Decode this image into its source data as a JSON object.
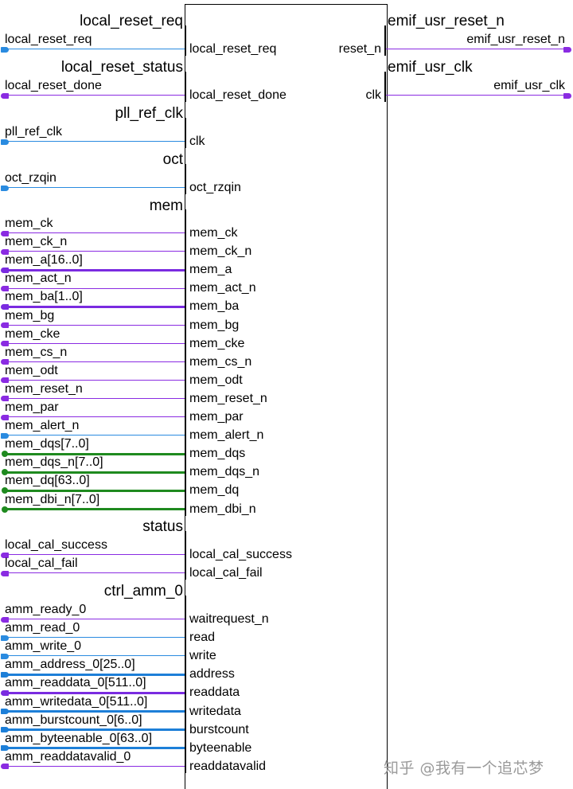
{
  "colors": {
    "blue": "#2a8be0",
    "purple": "#8a2be2",
    "green": "#1f8a1f",
    "bus_blue": "#1d7fd8",
    "bus_purple": "#7a2be0"
  },
  "output_groups": [
    {
      "group": "emif_usr_reset_n",
      "signal": "emif_usr_reset_n",
      "port": "reset_n",
      "color": "purple"
    },
    {
      "group": "emif_usr_clk",
      "signal": "emif_usr_clk",
      "port": "clk",
      "color": "purple"
    }
  ],
  "input_groups": [
    {
      "group": "local_reset_req",
      "signals": [
        {
          "name": "local_reset_req",
          "port": "local_reset_req",
          "color": "blue",
          "bus": false,
          "term": "in"
        }
      ]
    },
    {
      "group": "local_reset_status",
      "signals": [
        {
          "name": "local_reset_done",
          "port": "local_reset_done",
          "color": "purple",
          "bus": false,
          "term": "out"
        }
      ]
    },
    {
      "group": "pll_ref_clk",
      "signals": [
        {
          "name": "pll_ref_clk",
          "port": "clk",
          "color": "blue",
          "bus": false,
          "term": "in"
        }
      ]
    },
    {
      "group": "oct",
      "signals": [
        {
          "name": "oct_rzqin",
          "port": "oct_rzqin",
          "color": "blue",
          "bus": false,
          "term": "in"
        }
      ]
    },
    {
      "group": "mem",
      "signals": [
        {
          "name": "mem_ck",
          "port": "mem_ck",
          "color": "purple",
          "bus": false,
          "term": "out"
        },
        {
          "name": "mem_ck_n",
          "port": "mem_ck_n",
          "color": "purple",
          "bus": false,
          "term": "out"
        },
        {
          "name": "mem_a[16..0]",
          "port": "mem_a",
          "color": "purple",
          "bus": true,
          "term": "out"
        },
        {
          "name": "mem_act_n",
          "port": "mem_act_n",
          "color": "purple",
          "bus": false,
          "term": "out"
        },
        {
          "name": "mem_ba[1..0]",
          "port": "mem_ba",
          "color": "purple",
          "bus": true,
          "term": "out"
        },
        {
          "name": "mem_bg",
          "port": "mem_bg",
          "color": "purple",
          "bus": false,
          "term": "out"
        },
        {
          "name": "mem_cke",
          "port": "mem_cke",
          "color": "purple",
          "bus": false,
          "term": "out"
        },
        {
          "name": "mem_cs_n",
          "port": "mem_cs_n",
          "color": "purple",
          "bus": false,
          "term": "out"
        },
        {
          "name": "mem_odt",
          "port": "mem_odt",
          "color": "purple",
          "bus": false,
          "term": "out"
        },
        {
          "name": "mem_reset_n",
          "port": "mem_reset_n",
          "color": "purple",
          "bus": false,
          "term": "out"
        },
        {
          "name": "mem_par",
          "port": "mem_par",
          "color": "purple",
          "bus": false,
          "term": "out"
        },
        {
          "name": "mem_alert_n",
          "port": "mem_alert_n",
          "color": "blue",
          "bus": false,
          "term": "in"
        },
        {
          "name": "mem_dqs[7..0]",
          "port": "mem_dqs",
          "color": "green",
          "bus": true,
          "term": "bidir"
        },
        {
          "name": "mem_dqs_n[7..0]",
          "port": "mem_dqs_n",
          "color": "green",
          "bus": true,
          "term": "bidir"
        },
        {
          "name": "mem_dq[63..0]",
          "port": "mem_dq",
          "color": "green",
          "bus": true,
          "term": "bidir"
        },
        {
          "name": "mem_dbi_n[7..0]",
          "port": "mem_dbi_n",
          "color": "green",
          "bus": true,
          "term": "bidir"
        }
      ]
    },
    {
      "group": "status",
      "signals": [
        {
          "name": "local_cal_success",
          "port": "local_cal_success",
          "color": "purple",
          "bus": false,
          "term": "out"
        },
        {
          "name": "local_cal_fail",
          "port": "local_cal_fail",
          "color": "purple",
          "bus": false,
          "term": "out"
        }
      ]
    },
    {
      "group": "ctrl_amm_0",
      "signals": [
        {
          "name": "amm_ready_0",
          "port": "waitrequest_n",
          "color": "purple",
          "bus": false,
          "term": "out"
        },
        {
          "name": "amm_read_0",
          "port": "read",
          "color": "blue",
          "bus": false,
          "term": "in"
        },
        {
          "name": "amm_write_0",
          "port": "write",
          "color": "blue",
          "bus": false,
          "term": "in"
        },
        {
          "name": "amm_address_0[25..0]",
          "port": "address",
          "color": "blue",
          "bus": true,
          "term": "in"
        },
        {
          "name": "amm_readdata_0[511..0]",
          "port": "readdata",
          "color": "purple",
          "bus": true,
          "term": "out"
        },
        {
          "name": "amm_writedata_0[511..0]",
          "port": "writedata",
          "color": "blue",
          "bus": true,
          "term": "in"
        },
        {
          "name": "amm_burstcount_0[6..0]",
          "port": "burstcount",
          "color": "blue",
          "bus": true,
          "term": "in"
        },
        {
          "name": "amm_byteenable_0[63..0]",
          "port": "byteenable",
          "color": "blue",
          "bus": true,
          "term": "in"
        },
        {
          "name": "amm_readdatavalid_0",
          "port": "readdatavalid",
          "color": "purple",
          "bus": false,
          "term": "out"
        }
      ]
    }
  ],
  "watermark": "知乎 @我有一个追芯梦"
}
